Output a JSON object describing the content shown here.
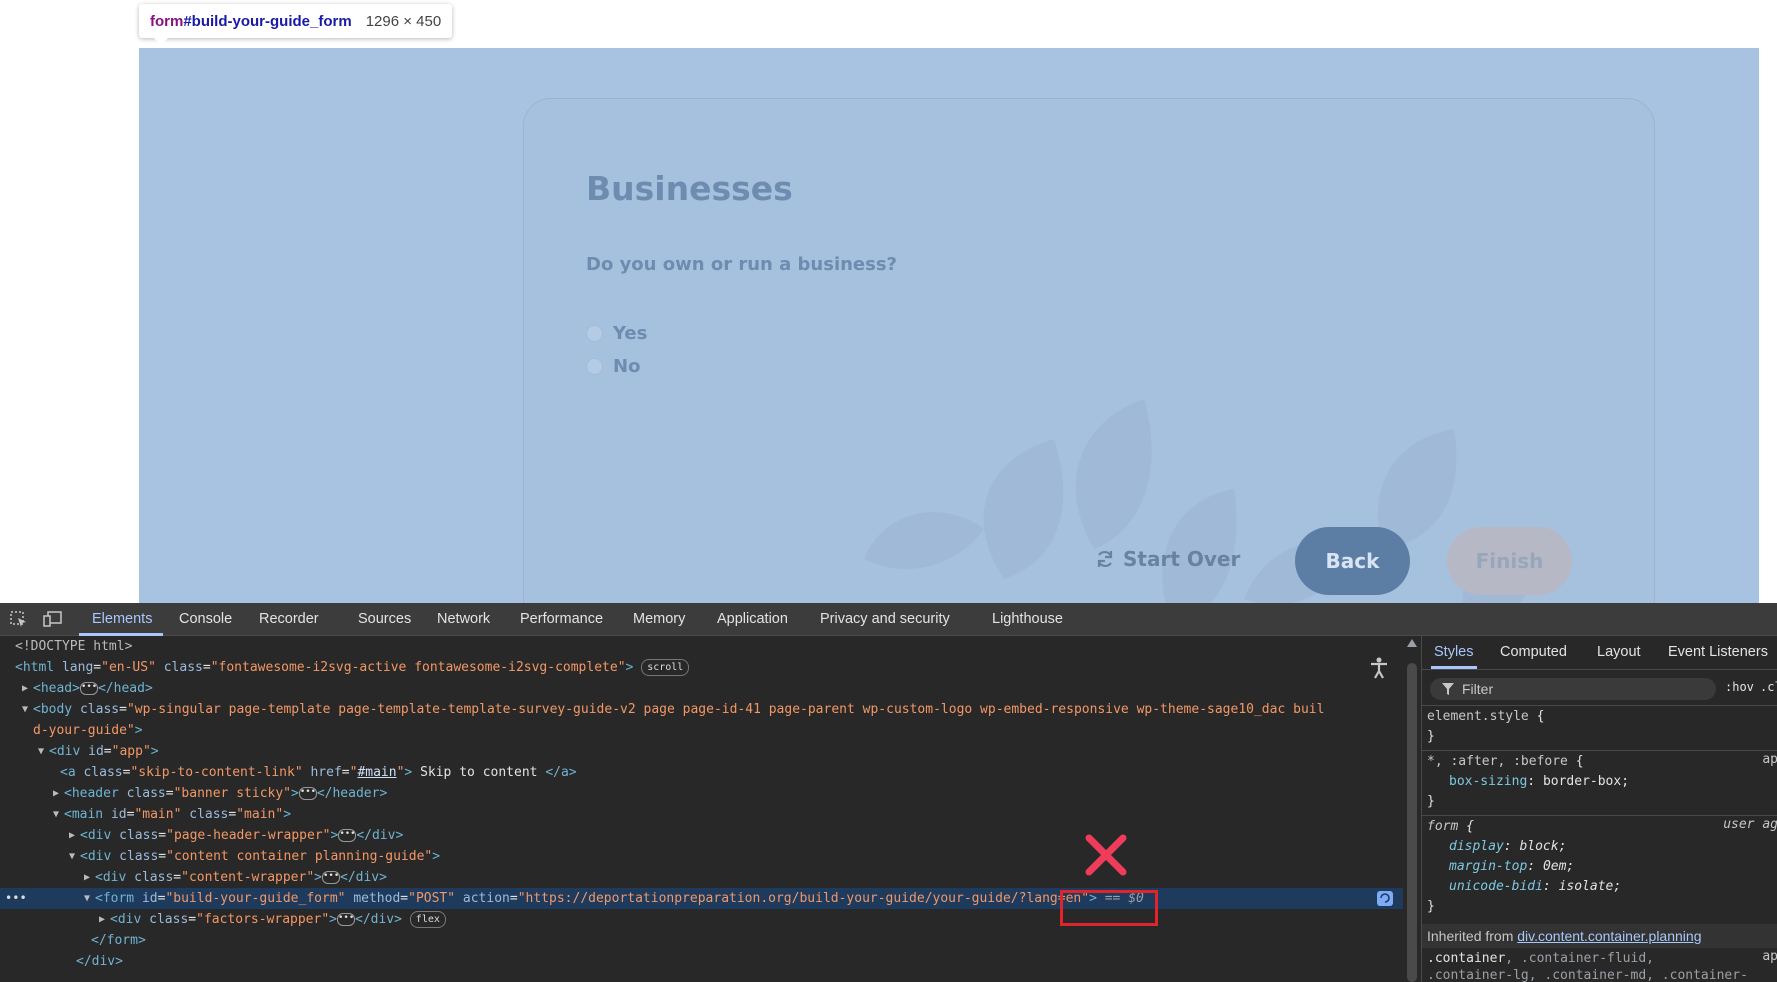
{
  "tooltip": {
    "tag": "form",
    "id": "#build-your-guide_form",
    "size": "1296 × 450"
  },
  "card": {
    "title": "Businesses",
    "question": "Do you own or run a business?",
    "options": [
      "Yes",
      "No"
    ],
    "start_over": "Start Over",
    "back": "Back",
    "finish": "Finish"
  },
  "devtools": {
    "tabs": [
      "Elements",
      "Console",
      "Recorder",
      "Sources",
      "Network",
      "Performance",
      "Memory",
      "Application",
      "Privacy and security",
      "Lighthouse"
    ],
    "active_tab": "Elements",
    "dom": {
      "doctype": "<!DOCTYPE html>",
      "html_tag": "html",
      "html_lang": "en-US",
      "html_class": "fontawesome-i2svg-active fontawesome-i2svg-complete",
      "scroll_badge": "scroll",
      "head_tag": "head",
      "body_tag": "body",
      "body_class_1": "wp-singular page-template page-template-template-survey-guide-v2 page page-id-41 page-parent wp-custom-logo wp-embed-responsive wp-theme-sage10_dac buil",
      "body_class_2": "d-your-guide",
      "app_tag": "div",
      "app_id": "app",
      "skip_tag": "a",
      "skip_class": "skip-to-content-link",
      "skip_href": "#main",
      "skip_text": " Skip to content ",
      "header_tag": "header",
      "header_class": "banner sticky",
      "main_tag": "main",
      "main_id": "main",
      "main_class": "main",
      "div_tag": "div",
      "page_header_class": "page-header-wrapper",
      "content_class": "content container planning-guide",
      "content_wrapper_class": "content-wrapper",
      "form_tag": "form",
      "form_id": "build-your-guide_form",
      "form_method": "POST",
      "form_action_1": "https://deportationpreparation.org/build-your-guide/your-guide/",
      "form_action_2": "?lang=en",
      "dollar": "== $0",
      "factors_class": "factors-wrapper",
      "flex_badge": "flex",
      "form_close": "</form>",
      "div_close": "</div>"
    },
    "styles": {
      "tabs": [
        "Styles",
        "Computed",
        "Layout",
        "Event Listeners"
      ],
      "active_tab": "Styles",
      "filter_placeholder": "Filter",
      "hov": ":hov",
      "cls": ".cl",
      "rule1_selector": "element.style",
      "rule2_selector": "*, :after, :before",
      "rule2_prop": "box-sizing",
      "rule2_value": "border-box",
      "rule2_origin": "ap",
      "rule3_selector": "form",
      "rule3_origin": "user ag",
      "rule3_props": [
        {
          "prop": "display",
          "value": "block"
        },
        {
          "prop": "margin-top",
          "value": "0em"
        },
        {
          "prop": "unicode-bidi",
          "value": "isolate"
        }
      ],
      "inherited_label": "Inherited from",
      "inherited_from": "div.content.container.planning",
      "container_sel_1": ".container",
      "container_sel_2": ", .container-fluid,",
      "container_sel_3": ".container-lg, .container-md, .container-",
      "container_origin": "ap"
    }
  },
  "colors": {
    "overlay": "#a8c3e1",
    "back_button": "#5c7ea5",
    "finish_button": "#b6b8c6",
    "annotation_red": "#e0242c",
    "devtools_bg": "#282828",
    "selected_row": "#1e3a5c"
  }
}
